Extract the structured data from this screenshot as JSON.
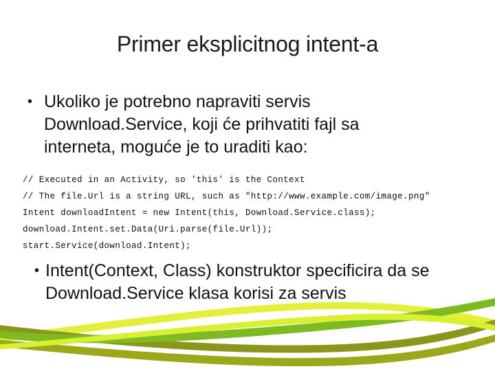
{
  "slide": {
    "title": "Primer eksplicitnog intent-a",
    "bullet_mark": "•",
    "bullets_top": [
      "Ukoliko je potrebno napraviti servis Download.Service, koji će prihvatiti fajl sa interneta, moguće je to uraditi kao:"
    ],
    "code_lines": [
      "// Executed in an Activity, so 'this' is the Context",
      "// The file.Url is a string URL, such as \"http://www.example.com/image.png\"",
      "Intent downloadIntent = new Intent(this, Download.Service.class);",
      "download.Intent.set.Data(Uri.parse(file.Url));",
      "start.Service(download.Intent);"
    ],
    "bullets_bottom": [
      "Intent(Context, Class) konstruktor specificira da se Download.Service klasa korisi za servis"
    ],
    "colors": {
      "title_text": "#1a1a1a",
      "body_text": "#111111",
      "code_text": "#0d0d0d",
      "background": "#ffffff",
      "ribbon_chartreuse": "#d9ef32",
      "ribbon_yellow_green": "#e2f03a",
      "ribbon_green": "#7dbb20",
      "ribbon_olive": "#9aa81a",
      "ribbon_dark_olive": "#8a961c"
    }
  }
}
